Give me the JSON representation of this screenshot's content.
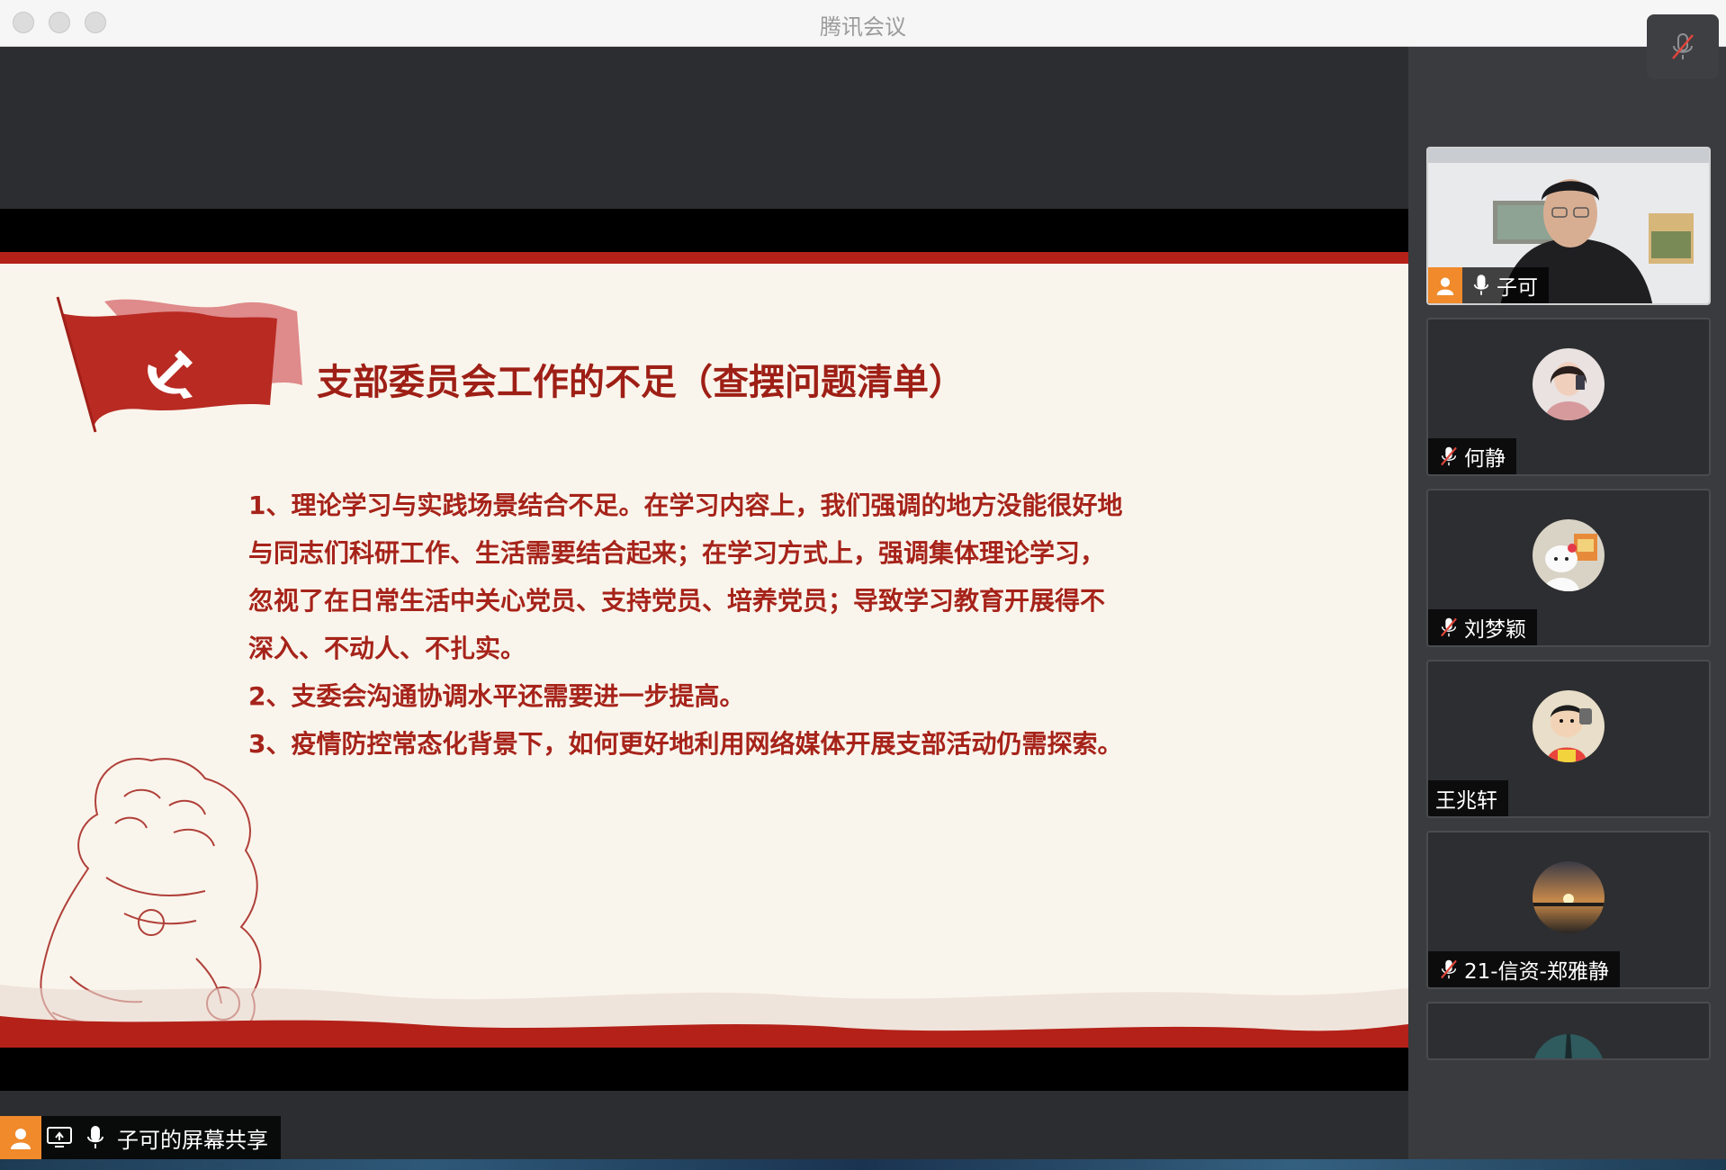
{
  "window": {
    "title": "腾讯会议"
  },
  "slide": {
    "title": "支部委员会工作的不足（查摆问题清单）",
    "lines": [
      "1、理论学习与实践场景结合不足。在学习内容上，我们强调的地方没能很好地",
      "与同志们科研工作、生活需要结合起来；在学习方式上，强调集体理论学习，",
      "忽视了在日常生活中关心党员、支持党员、培养党员；导致学习教育开展得不",
      "深入、不动人、不扎实。",
      "2、支委会沟通协调水平还需要进一步提高。",
      "3、疫情防控常态化背景下，如何更好地利用网络媒体开展支部活动仍需探索。"
    ]
  },
  "share_tag": {
    "label": "子可的屏幕共享"
  },
  "participants": [
    {
      "name": "子可",
      "mic": "on",
      "video": "on"
    },
    {
      "name": "何静",
      "mic": "muted",
      "video": "off"
    },
    {
      "name": "刘梦颖",
      "mic": "muted",
      "video": "off"
    },
    {
      "name": "王兆轩",
      "mic": "none",
      "video": "off"
    },
    {
      "name": "21-信资-郑雅静",
      "mic": "muted",
      "video": "off"
    }
  ],
  "colors": {
    "accent_red": "#b32119",
    "slide_bg": "#faf5ec",
    "host_orange": "#f08a2b"
  }
}
